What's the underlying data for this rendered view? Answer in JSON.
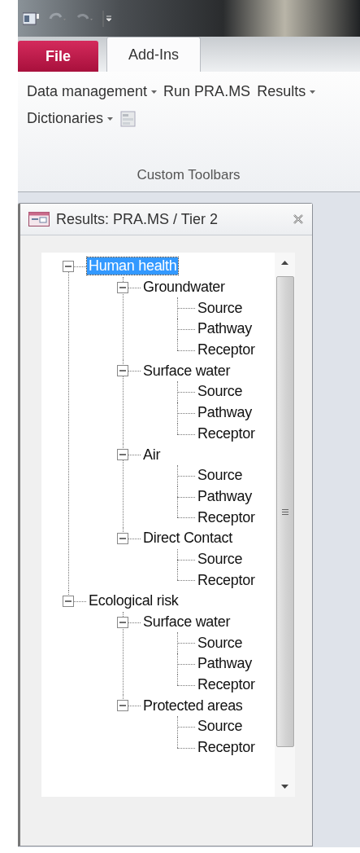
{
  "tabs": [
    {
      "label": "File",
      "kind": "file",
      "selected": false
    },
    {
      "label": "Add-Ins",
      "kind": "normal",
      "selected": true
    }
  ],
  "ribbon": {
    "rows": [
      [
        {
          "label": "Data management",
          "has_menu": true
        },
        {
          "label": "Run PRA.MS",
          "has_menu": false
        },
        {
          "label": "Results",
          "has_menu": true
        }
      ],
      [
        {
          "label": "Dictionaries",
          "has_menu": true,
          "icon_after": true
        }
      ]
    ],
    "group_label": "Custom Toolbars"
  },
  "panel": {
    "title": "Results: PRA.MS / Tier 2",
    "tree": [
      {
        "label": "Human health",
        "selected": true,
        "expanded": true,
        "children": [
          {
            "label": "Groundwater",
            "selected": false,
            "expanded": true,
            "children": [
              {
                "label": "Source",
                "selected": false
              },
              {
                "label": "Pathway",
                "selected": false
              },
              {
                "label": "Receptor",
                "selected": false
              }
            ]
          },
          {
            "label": "Surface water",
            "selected": false,
            "expanded": true,
            "children": [
              {
                "label": "Source",
                "selected": false
              },
              {
                "label": "Pathway",
                "selected": false
              },
              {
                "label": "Receptor",
                "selected": false
              }
            ]
          },
          {
            "label": "Air",
            "selected": false,
            "expanded": true,
            "children": [
              {
                "label": "Source",
                "selected": false
              },
              {
                "label": "Pathway",
                "selected": false
              },
              {
                "label": "Receptor",
                "selected": false
              }
            ]
          },
          {
            "label": "Direct Contact",
            "selected": false,
            "expanded": true,
            "children": [
              {
                "label": "Source",
                "selected": false
              },
              {
                "label": "Receptor",
                "selected": false
              }
            ]
          }
        ]
      },
      {
        "label": "Ecological risk",
        "selected": false,
        "expanded": true,
        "children": [
          {
            "label": "Surface water",
            "selected": false,
            "expanded": true,
            "children": [
              {
                "label": "Source",
                "selected": false
              },
              {
                "label": "Pathway",
                "selected": false
              },
              {
                "label": "Receptor",
                "selected": false
              }
            ]
          },
          {
            "label": "Protected areas",
            "selected": false,
            "expanded": true,
            "children": [
              {
                "label": "Source",
                "selected": false
              },
              {
                "label": "Receptor",
                "selected": false
              }
            ]
          }
        ]
      }
    ]
  }
}
